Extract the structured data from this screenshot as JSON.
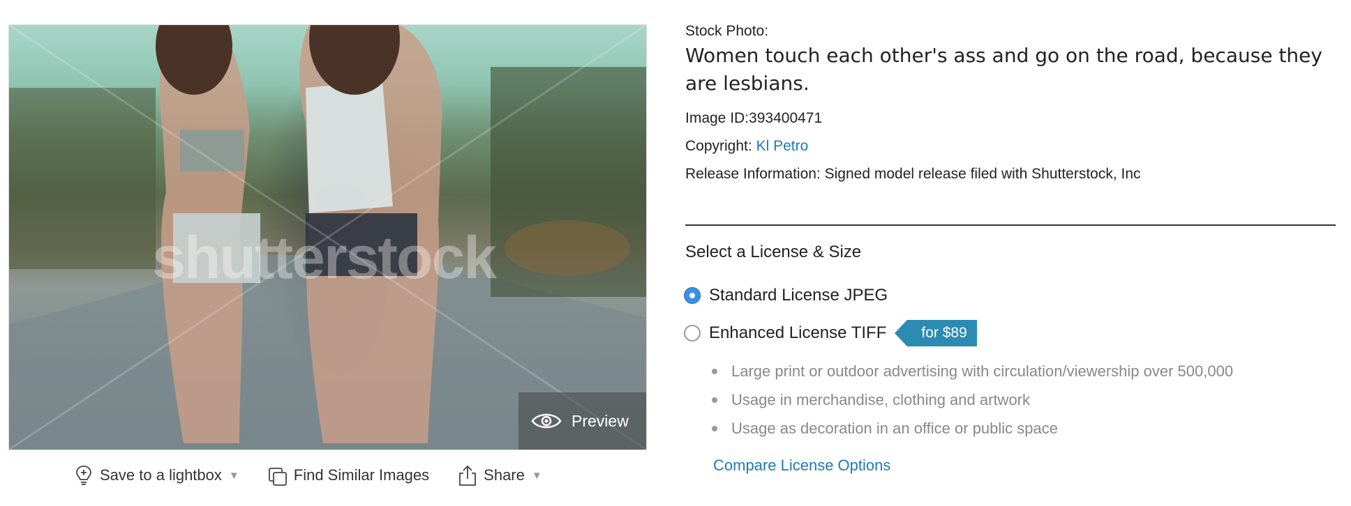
{
  "image": {
    "watermark_text": "shutterstock",
    "preview_label": "Preview"
  },
  "actions": {
    "save_label": "Save to a lightbox",
    "similar_label": "Find Similar Images",
    "share_label": "Share"
  },
  "info": {
    "stock_label": "Stock Photo:",
    "title": "Women touch each other's ass and go on the road, because they are lesbians.",
    "image_id_label": "Image ID:",
    "image_id": "393400471",
    "copyright_label": "Copyright:",
    "copyright_name": "Kl Petro",
    "release_label": "Release Information:",
    "release_value": "Signed model release filed with Shutterstock, Inc"
  },
  "license": {
    "heading": "Select a License & Size",
    "options": [
      {
        "label": "Standard License JPEG",
        "selected": true
      },
      {
        "label": "Enhanced License TIFF",
        "selected": false,
        "price": "for $89"
      }
    ],
    "features": [
      "Large print or outdoor advertising with circulation/viewership over 500,000",
      "Usage in merchandise, clothing and artwork",
      "Usage as decoration in an office or public space"
    ],
    "compare_link": "Compare License Options"
  },
  "colors": {
    "link": "#1d7ab8",
    "radio_selected": "#3b8fe5",
    "price_tag": "#2c8bb3"
  },
  "icons": [
    "lightbulb-icon",
    "similar-images-icon",
    "share-icon",
    "eye-icon",
    "caret-down-icon"
  ]
}
